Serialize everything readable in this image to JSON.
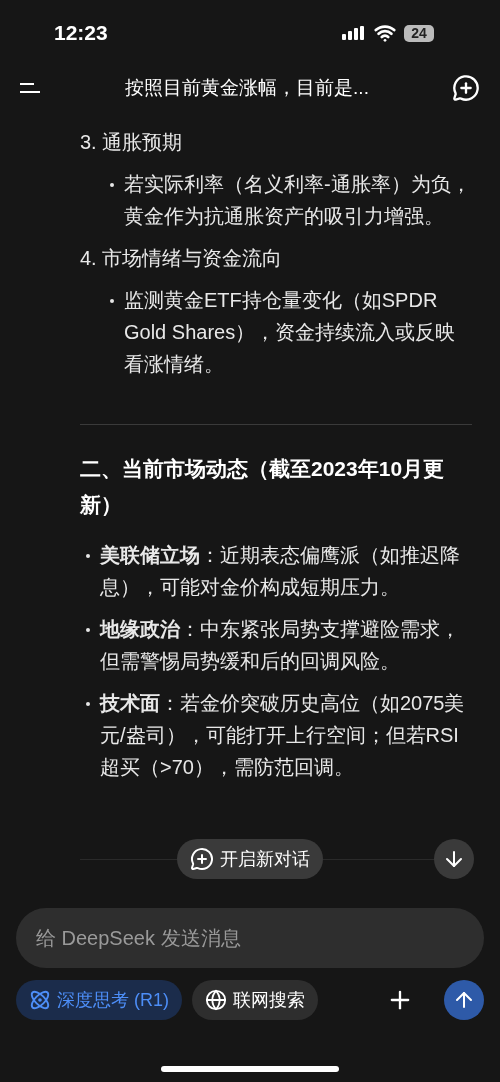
{
  "status_bar": {
    "time": "12:23",
    "battery": "24"
  },
  "header": {
    "title": "按照目前黄金涨幅，目前是..."
  },
  "message": {
    "sections": [
      {
        "kind": "numbered",
        "title": "3. 通胀预期",
        "bullets": [
          "若实际利率（名义利率-通胀率）为负，黄金作为抗通胀资产的吸引力增强。"
        ]
      },
      {
        "kind": "numbered",
        "title": "4. 市场情绪与资金流向",
        "bullets": [
          "监测黄金ETF持仓量变化（如SPDR Gold Shares），资金持续流入或反映看涨情绪。"
        ]
      },
      {
        "kind": "heading",
        "title": "二、当前市场动态（截至2023年10月更新）",
        "bullets": [
          "**美联储立场**：近期表态偏鹰派（如推迟降息），可能对金价构成短期压力。",
          "**地缘政治**：中东紧张局势支撑避险需求，但需警惕局势缓和后的回调风险。",
          "**技术面**：若金价突破历史高位（如2075美元/盎司），可能打开上行空间；但若RSI超买（>70），需防范回调。"
        ]
      }
    ]
  },
  "new_chat_button": "开启新对话",
  "composer": {
    "placeholder": "给 DeepSeek 发送消息"
  },
  "toggles": [
    {
      "kind": "think",
      "label": "深度思考 (R1)",
      "selected": true
    },
    {
      "kind": "search",
      "label": "联网搜索",
      "selected": false
    }
  ]
}
